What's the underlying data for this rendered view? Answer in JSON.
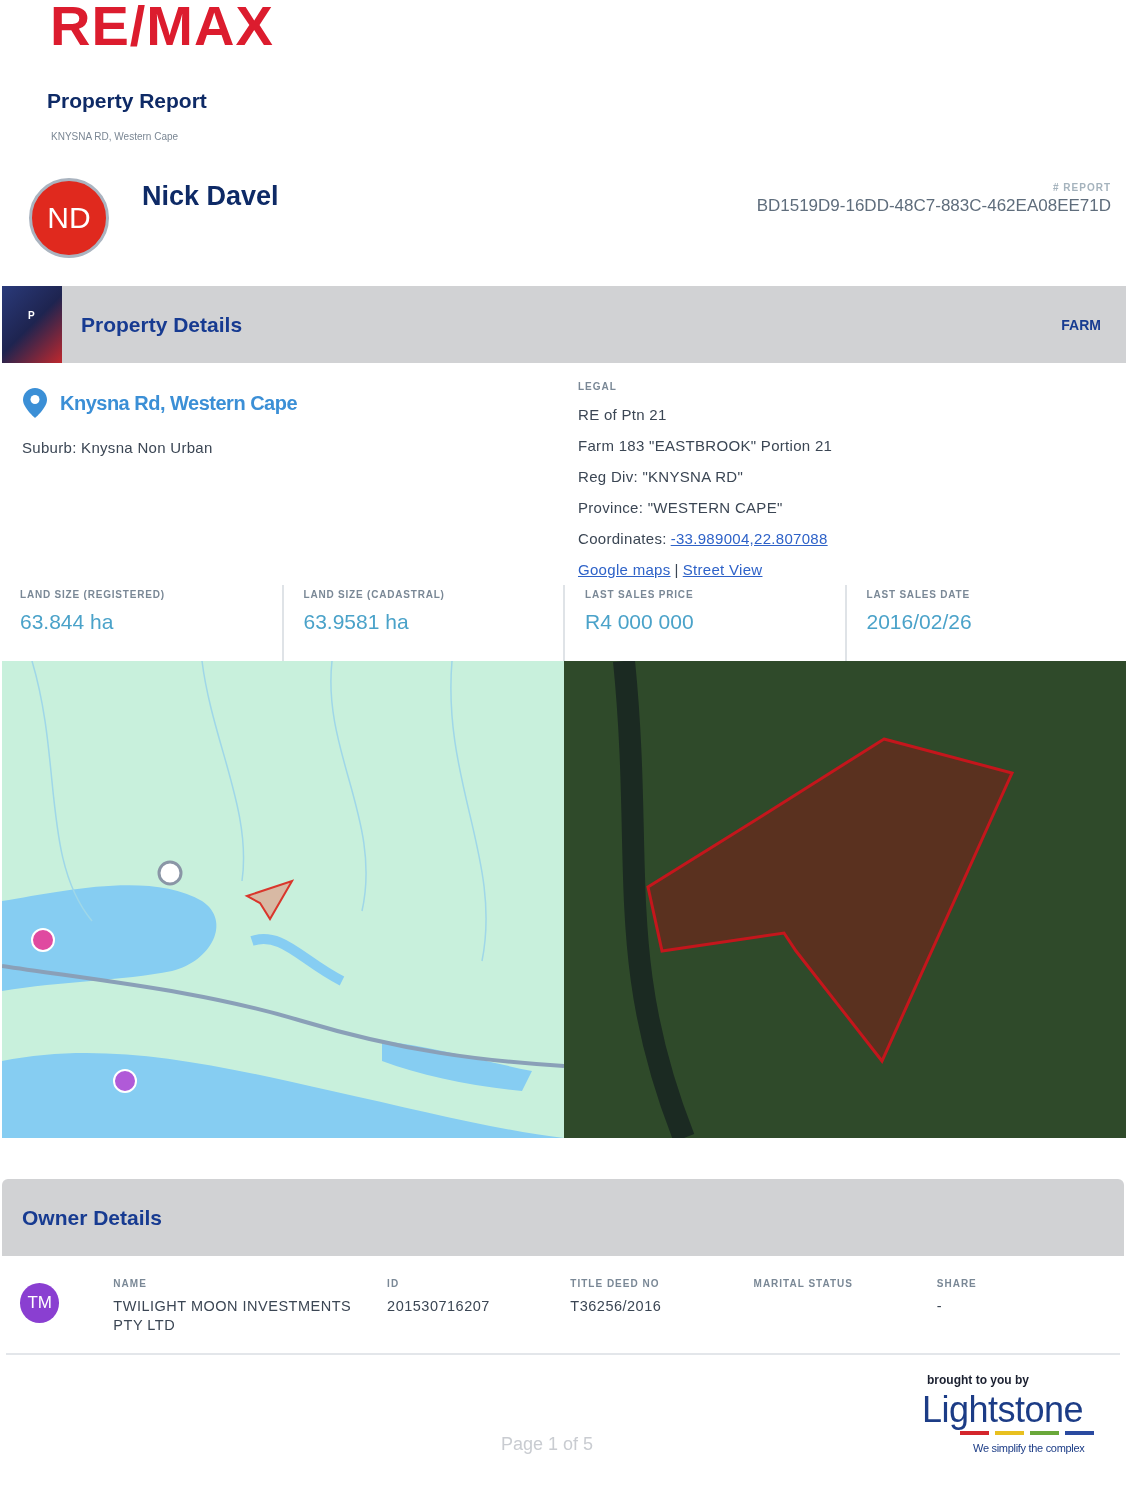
{
  "logo": "RE/MAX",
  "header": {
    "title": "Property Report",
    "subtitle": "KNYSNA RD, Western Cape"
  },
  "agent": {
    "initials": "ND",
    "name": "Nick Davel"
  },
  "report": {
    "label": "# REPORT",
    "id": "BD1519D9-16DD-48C7-883C-462EA08EE71D"
  },
  "property_details": {
    "badge": "P",
    "title": "Property Details",
    "type": "FARM",
    "address": "Knysna Rd, Western Cape",
    "suburb": "Suburb: Knysna Non Urban",
    "legal": {
      "label": "LEGAL",
      "lines": [
        "RE of Ptn 21",
        "Farm 183 \"EASTBROOK\" Portion 21",
        "Reg Div: \"KNYSNA RD\"",
        "Province: \"WESTERN CAPE\""
      ],
      "coordinates": {
        "label": "Coordinates:",
        "value": "-33.989004,22.807088"
      },
      "links": [
        "Google maps",
        "Street View"
      ],
      "separator": "|"
    }
  },
  "stats": [
    {
      "label": "LAND SIZE (REGISTERED)",
      "value": "63.844 ha"
    },
    {
      "label": "LAND SIZE (CADASTRAL)",
      "value": "63.9581 ha"
    },
    {
      "label": "LAST SALES PRICE",
      "value": "R4 000 000"
    },
    {
      "label": "LAST SALES DATE",
      "value": "2016/02/26"
    }
  ],
  "owner_details": {
    "title": "Owner Details",
    "owners": [
      {
        "initials": "TM",
        "fields": [
          {
            "label": "NAME",
            "value": "TWILIGHT MOON INVESTMENTS PTY LTD"
          },
          {
            "label": "ID",
            "value": "201530716207"
          },
          {
            "label": "TITLE DEED NO",
            "value": "T36256/2016"
          },
          {
            "label": "MARITAL STATUS"
          },
          {
            "label": "SHARE",
            "value": "-"
          }
        ]
      }
    ]
  },
  "footer": {
    "brought_by": "brought to you by",
    "brand": "Lightstone",
    "tagline": "We simplify the complex",
    "page": "Page 1 of 5"
  }
}
